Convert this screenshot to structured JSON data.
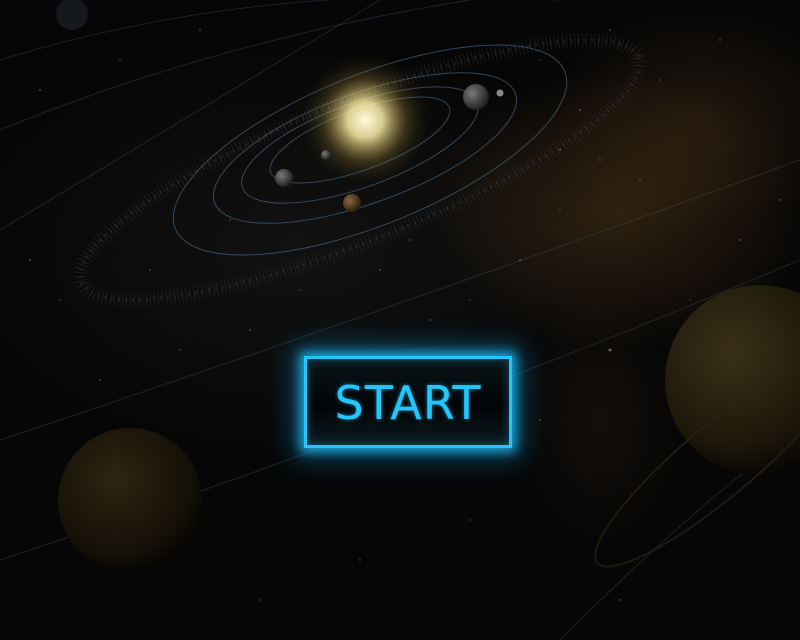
{
  "screen": "title",
  "start_button": {
    "label": "START",
    "color": "#22c7ff"
  },
  "background": {
    "theme": "solar system",
    "sun_color": "#fff6c8",
    "space_color": "#060606"
  }
}
